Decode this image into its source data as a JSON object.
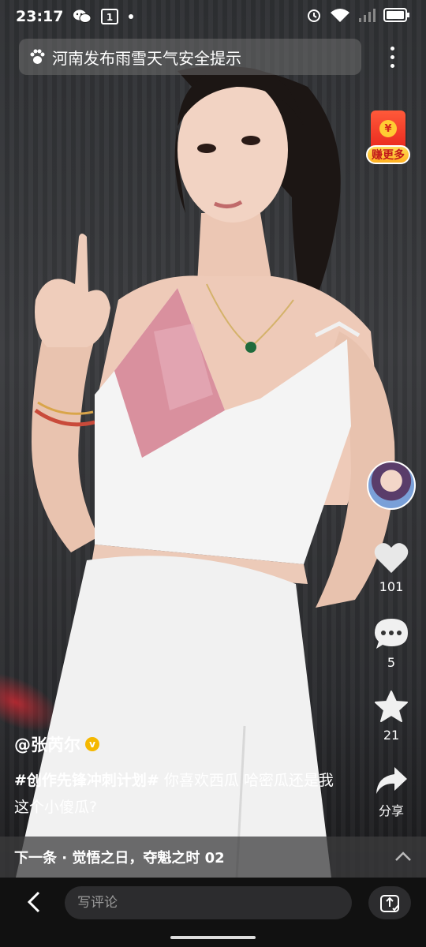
{
  "status_bar": {
    "time": "23:17",
    "notification_badge": "1",
    "icons": [
      "wechat-icon",
      "notification-icon",
      "dot",
      "alarm-icon",
      "wifi-icon",
      "signal-icon",
      "battery-icon"
    ]
  },
  "search": {
    "query": "河南发布雨雪天气安全提示",
    "icon": "paw-icon"
  },
  "red_packet": {
    "coin_symbol": "¥",
    "label": "赚更多"
  },
  "actions": {
    "like_count": "101",
    "comment_count": "5",
    "favorite_count": "21",
    "share_label": "分享"
  },
  "post": {
    "author": "@张芮尔",
    "verified_symbol": "v",
    "hashtag": "#创作先锋冲刺计划#",
    "text": " 你喜欢西瓜 哈密瓜还是我这个小傻瓜?"
  },
  "next": {
    "label": "下一条 · 觉悟之日，夺魁之时 02"
  },
  "bottom": {
    "comment_placeholder": "写评论"
  },
  "colors": {
    "background": "#000000",
    "overlay_bar": "#3c3c3e",
    "input_bg": "#2c2c2e",
    "red_packet": "#e8261c",
    "badge_gold": "#f5b800"
  }
}
